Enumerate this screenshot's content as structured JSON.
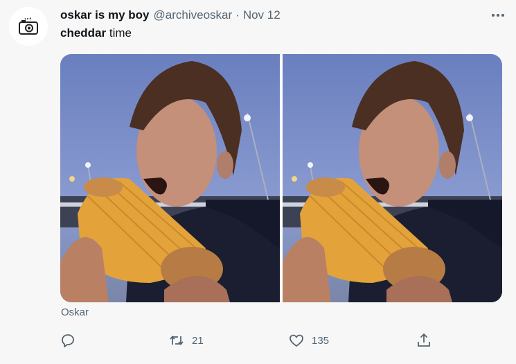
{
  "tweet": {
    "display_name": "oskar is my boy",
    "handle": "@archiveoskar",
    "separator": "·",
    "date": "Nov 12",
    "text_bold": "cheddar",
    "text_rest": " time",
    "caption": "Oskar"
  },
  "icons": {
    "avatar": "camera-icon",
    "more": "more-icon",
    "reply": "reply-icon",
    "retweet": "retweet-icon",
    "like": "like-icon",
    "share": "share-icon"
  },
  "actions": {
    "retweet_count": "21",
    "like_count": "135"
  },
  "colors": {
    "text": "#0f1419",
    "secondary": "#536471",
    "background": "#f7f7f7"
  }
}
